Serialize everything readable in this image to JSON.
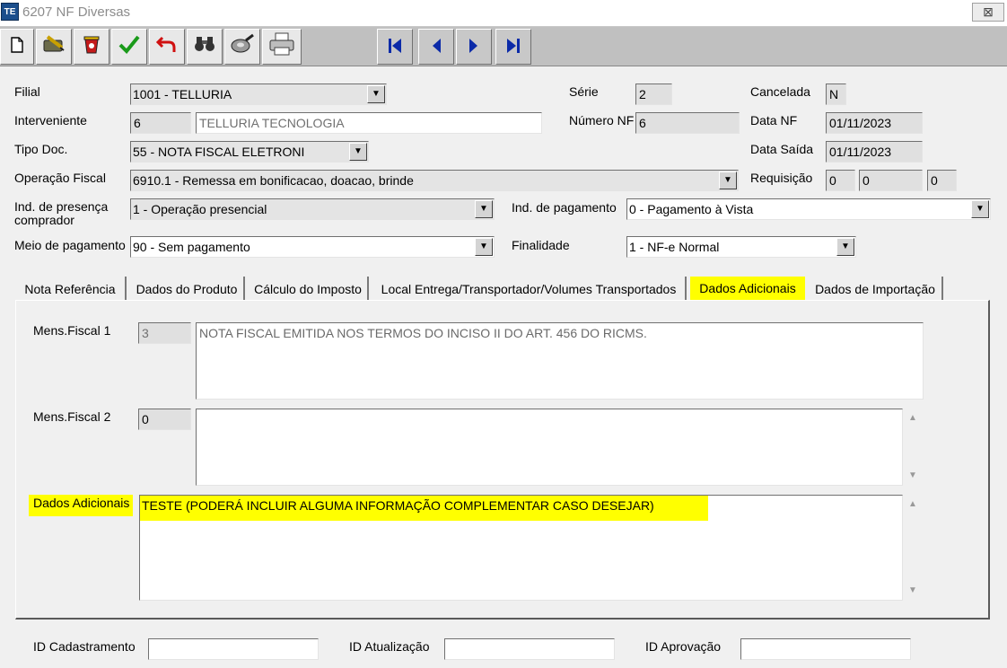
{
  "window": {
    "icon_text": "TE",
    "title": "6207 NF Diversas",
    "close_glyph": "⊠"
  },
  "toolbar": {
    "buttons": [
      {
        "name": "new-icon",
        "glyph": "🗋"
      },
      {
        "name": "edit-icon",
        "glyph": "✎"
      },
      {
        "name": "delete-icon",
        "glyph": "🗑"
      },
      {
        "name": "confirm-icon",
        "glyph": "✔"
      },
      {
        "name": "undo-icon",
        "glyph": "↶"
      },
      {
        "name": "find-icon",
        "glyph": "🔭"
      },
      {
        "name": "filter-icon",
        "glyph": "◎"
      },
      {
        "name": "print-icon",
        "glyph": "🖶"
      }
    ],
    "nav": [
      {
        "name": "first-record-icon",
        "glyph": "|◀"
      },
      {
        "name": "previous-record-icon",
        "glyph": "◀"
      },
      {
        "name": "next-record-icon",
        "glyph": "▶"
      },
      {
        "name": "last-record-icon",
        "glyph": "▶|"
      }
    ]
  },
  "form": {
    "filial": {
      "label": "Filial",
      "value": "1001 - TELLURIA"
    },
    "interveniente": {
      "label": "Interveniente",
      "code": "6",
      "name": "TELLURIA TECNOLOGIA"
    },
    "tipo_doc": {
      "label": "Tipo Doc.",
      "value": "55 - NOTA FISCAL ELETRONI"
    },
    "operacao_fiscal": {
      "label": "Operação Fiscal",
      "value": "6910.1 - Remessa em bonificacao, doacao, brinde"
    },
    "ind_presenca": {
      "label": "Ind. de presença comprador",
      "value": "1 - Operação presencial"
    },
    "meio_pagamento": {
      "label": "Meio de pagamento",
      "value": "90 - Sem pagamento"
    },
    "serie": {
      "label": "Série",
      "value": "2"
    },
    "numero_nf": {
      "label": "Número NF",
      "value": "6"
    },
    "ind_pagamento": {
      "label": "Ind. de pagamento",
      "value": "0 - Pagamento à Vista"
    },
    "finalidade": {
      "label": "Finalidade",
      "value": "1 - NF-e Normal"
    },
    "cancelada": {
      "label": "Cancelada",
      "value": "N"
    },
    "data_nf": {
      "label": "Data NF",
      "value": "01/11/2023"
    },
    "data_saida": {
      "label": "Data Saída",
      "value": "01/11/2023"
    },
    "requisicao": {
      "label": "Requisição",
      "values": [
        "0",
        "0",
        "0"
      ]
    }
  },
  "tabs": [
    {
      "label": "Nota Referência",
      "active": false
    },
    {
      "label": "Dados do Produto",
      "active": false
    },
    {
      "label": "Cálculo do Imposto",
      "active": false
    },
    {
      "label": "Local Entrega/Transportador/Volumes Transportados",
      "active": false
    },
    {
      "label": "Dados Adicionais",
      "active": true
    },
    {
      "label": "Dados de Importação",
      "active": false
    }
  ],
  "panel": {
    "mens_fiscal_1": {
      "label": "Mens.Fiscal 1",
      "code": "3",
      "text": "NOTA FISCAL EMITIDA NOS TERMOS DO INCISO II DO ART. 456 DO RICMS."
    },
    "mens_fiscal_2": {
      "label": "Mens.Fiscal 2",
      "code": "0",
      "text": ""
    },
    "dados_adicionais": {
      "label": "Dados Adicionais",
      "text": "TESTE (PODERÁ INCLUIR ALGUMA INFORMAÇÃO COMPLEMENTAR CASO DESEJAR)"
    },
    "scroll_up": "▲",
    "scroll_down": "▼"
  },
  "footer": {
    "id_cadastramento": {
      "label": "ID Cadastramento",
      "value": ""
    },
    "id_atualizacao": {
      "label": "ID Atualização",
      "value": ""
    },
    "id_aprovacao": {
      "label": "ID Aprovação",
      "value": ""
    }
  },
  "colors": {
    "highlight": "#ffff00",
    "toolbar": "#c0c0c0",
    "nav_arrow": "#0b2aa8"
  }
}
